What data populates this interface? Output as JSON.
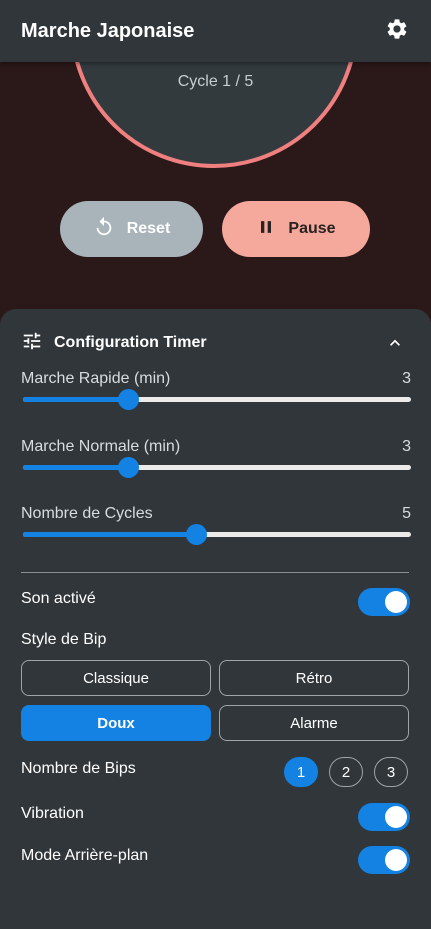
{
  "app": {
    "title": "Marche Japonaise"
  },
  "timer": {
    "cycle_text": "Cycle 1 / 5"
  },
  "controls": {
    "reset_label": "Reset",
    "pause_label": "Pause"
  },
  "config": {
    "title": "Configuration Timer",
    "sliders": [
      {
        "label": "Marche Rapide (min)",
        "value": "3",
        "fraction": 0.27
      },
      {
        "label": "Marche Normale (min)",
        "value": "3",
        "fraction": 0.27
      },
      {
        "label": "Nombre de Cycles",
        "value": "5",
        "fraction": 0.445
      }
    ],
    "sound": {
      "label": "Son activé",
      "on": true
    },
    "bip_style": {
      "label": "Style de Bip",
      "options": [
        "Classique",
        "Rétro",
        "Doux",
        "Alarme"
      ],
      "selected": "Doux"
    },
    "bip_count": {
      "label": "Nombre de Bips",
      "options": [
        "1",
        "2",
        "3"
      ],
      "selected": "1"
    },
    "vibration": {
      "label": "Vibration",
      "on": true
    },
    "background_mode": {
      "label": "Mode Arrière-plan",
      "on": true
    }
  },
  "colors": {
    "accent": "#1382e3",
    "ring": "#f08080",
    "pause": "#f4a99c",
    "reset": "#a9b4ba"
  }
}
